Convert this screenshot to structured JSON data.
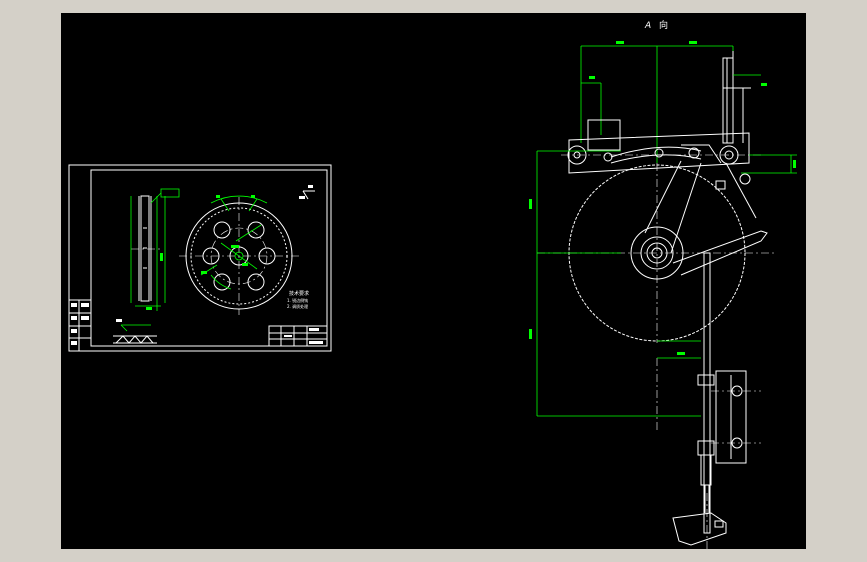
{
  "view_label": {
    "letter": "A",
    "char": "向"
  },
  "part_sheet": {
    "tech_title": "技术要求",
    "tech_notes": [
      "1. 锐边倒钝",
      "2. 调质处理"
    ]
  },
  "colors": {
    "background": "#000000",
    "geometry": "#ffffff",
    "dimension": "#00ff00",
    "frame": "#d4d0c8"
  }
}
